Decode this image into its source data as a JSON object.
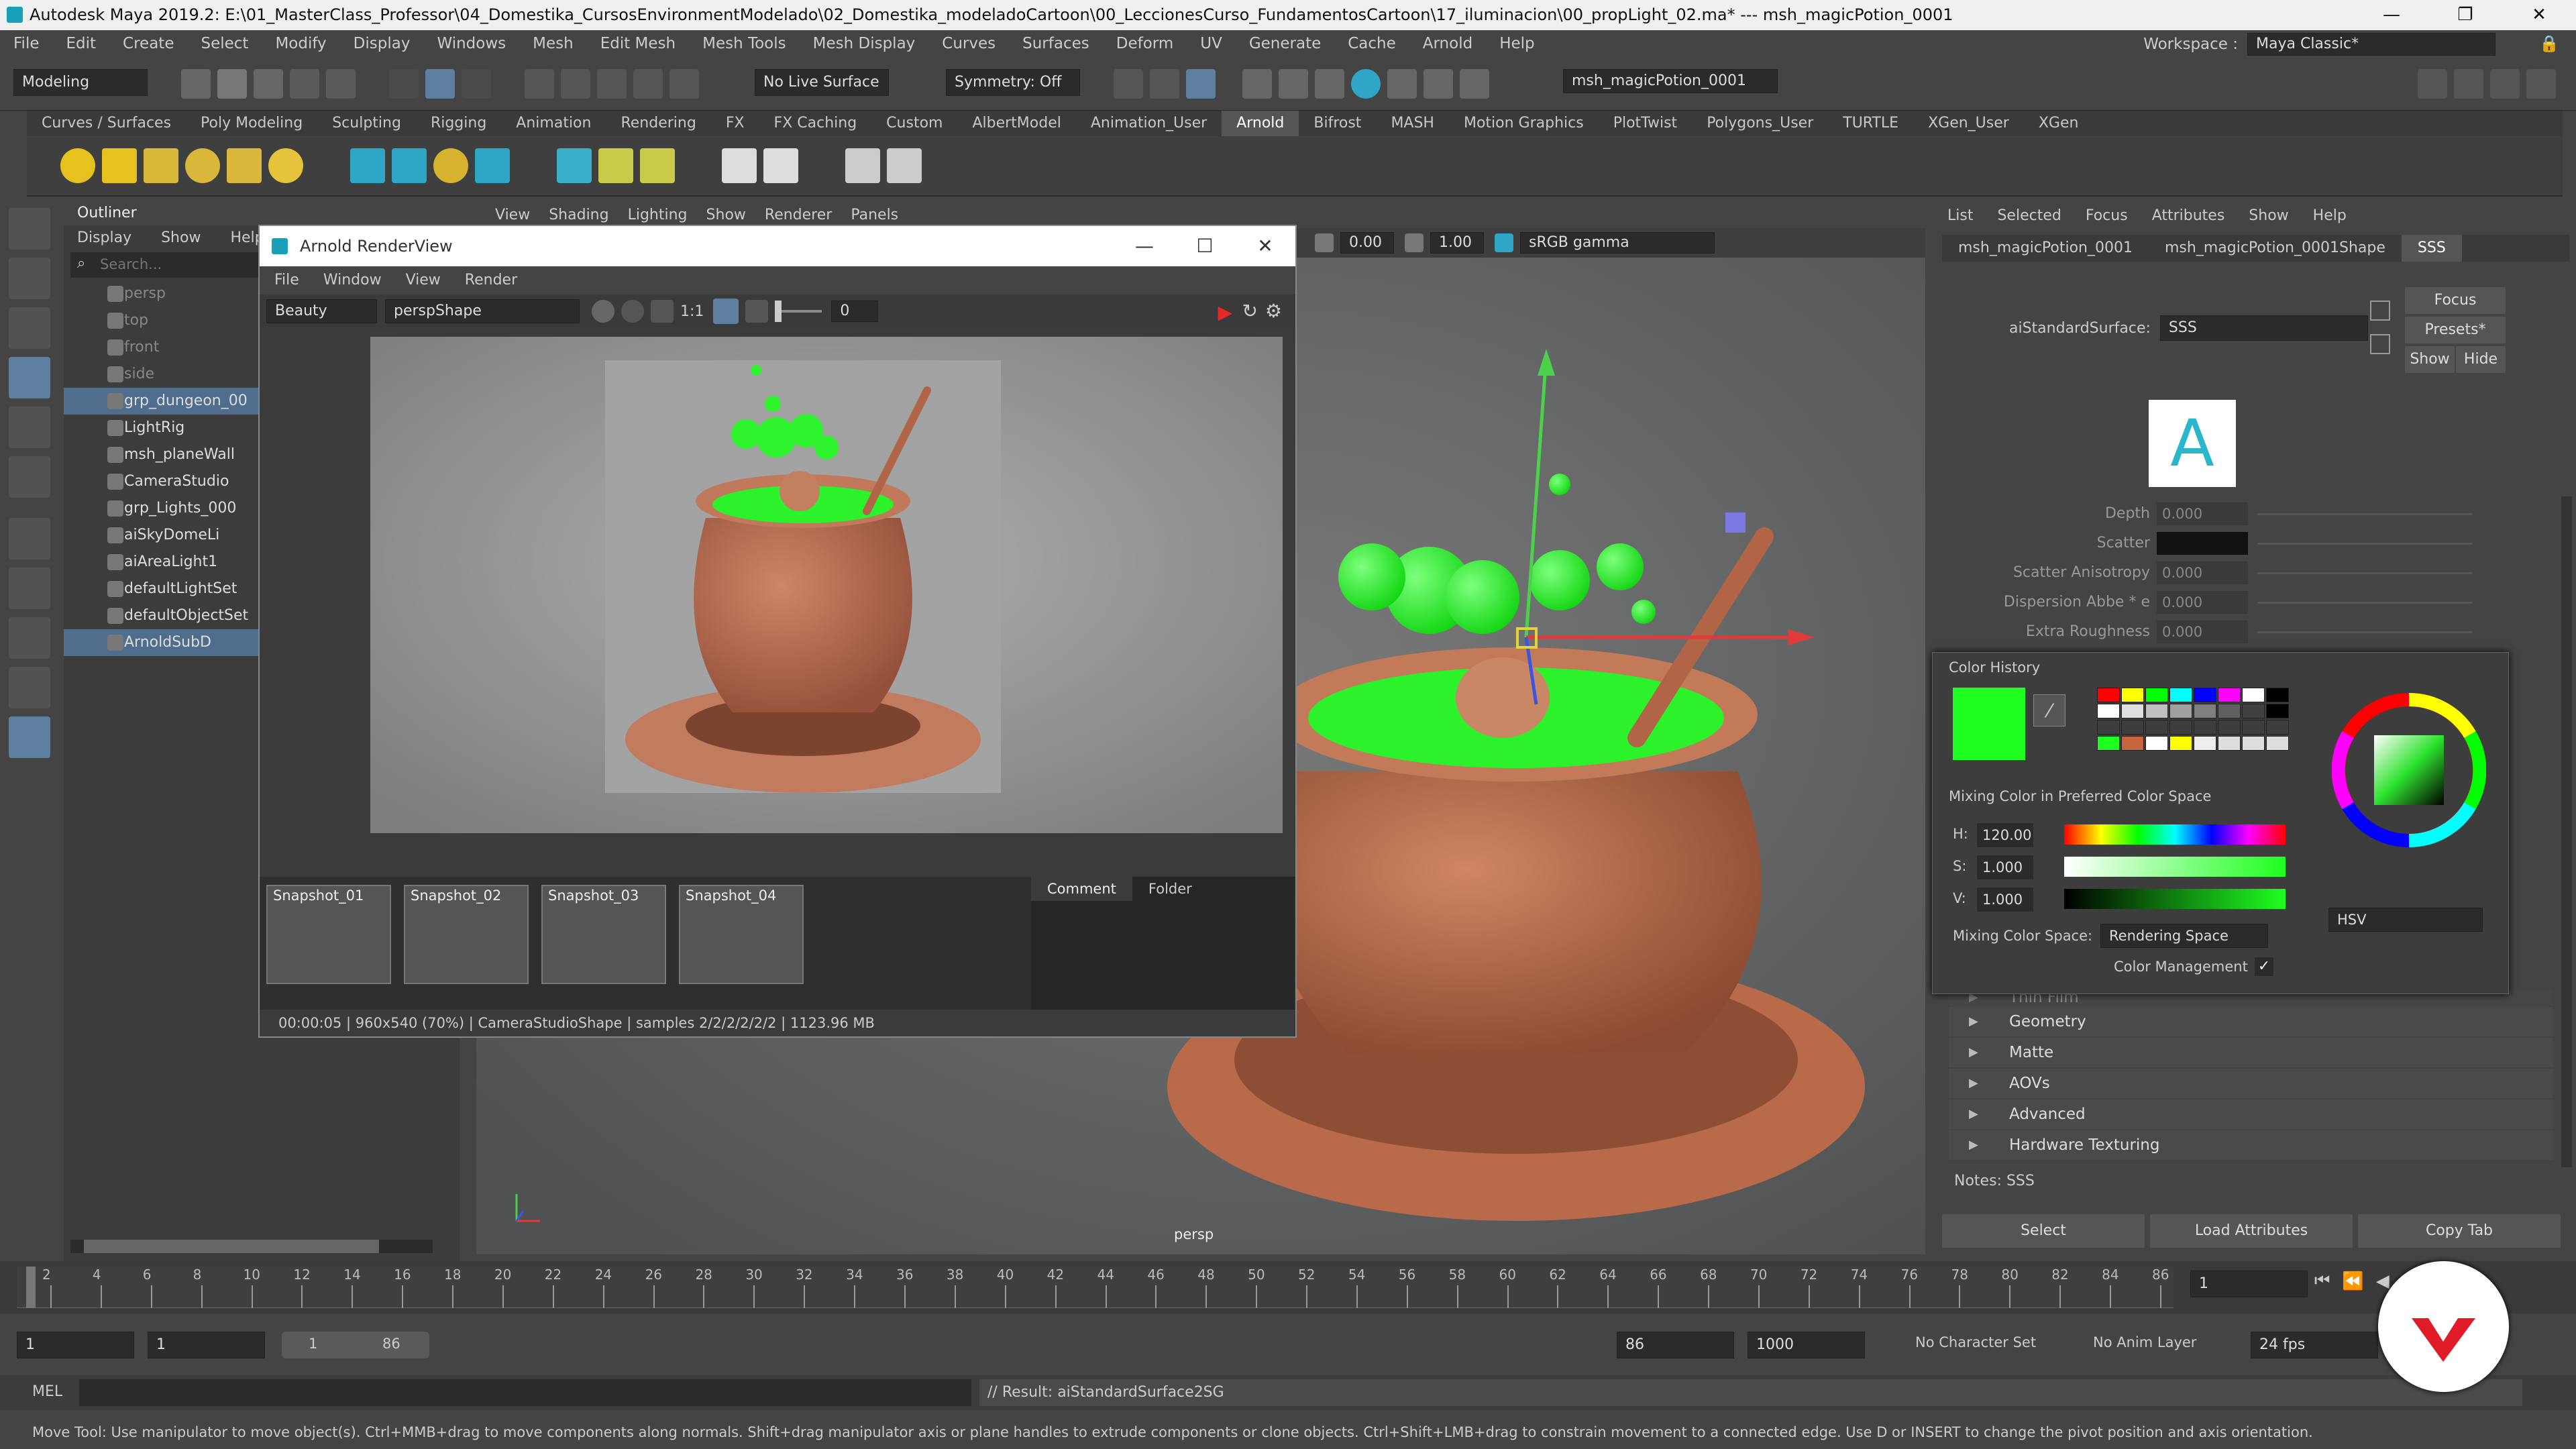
{
  "window": {
    "title": "Autodesk Maya 2019.2: E:\\01_MasterClass_Professor\\04_Domestika_CursosEnvironmentModelado\\02_Domestika_modeladoCartoon\\00_LeccionesCurso_FundamentosCartoon\\17_iluminacion\\00_propLight_02.ma*    ---    msh_magicPotion_0001"
  },
  "menu": [
    "File",
    "Edit",
    "Create",
    "Select",
    "Modify",
    "Display",
    "Windows",
    "Mesh",
    "Edit Mesh",
    "Mesh Tools",
    "Mesh Display",
    "Curves",
    "Surfaces",
    "Deform",
    "UV",
    "Generate",
    "Cache",
    "Arnold",
    "Help"
  ],
  "workspace": {
    "label": "Workspace :",
    "value": "Maya Classic*"
  },
  "toolbar": {
    "mode": "Modeling",
    "live_surface": "No Live Surface",
    "symmetry": "Symmetry: Off",
    "object_field": "msh_magicPotion_0001"
  },
  "shelf_tabs": [
    "Curves / Surfaces",
    "Poly Modeling",
    "Sculpting",
    "Rigging",
    "Animation",
    "Rendering",
    "FX",
    "FX Caching",
    "Custom",
    "AlbertModel",
    "Animation_User",
    "Arnold",
    "Bifrost",
    "MASH",
    "Motion Graphics",
    "PlotTwist",
    "Polygons_User",
    "TURTLE",
    "XGen_User",
    "XGen"
  ],
  "shelf_active": "Arnold",
  "outliner": {
    "title": "Outliner",
    "menu": [
      "Display",
      "Show",
      "Help"
    ],
    "search_placeholder": "Search...",
    "items": [
      {
        "label": "persp",
        "dim": true
      },
      {
        "label": "top",
        "dim": true
      },
      {
        "label": "front",
        "dim": true
      },
      {
        "label": "side",
        "dim": true
      },
      {
        "label": "grp_dungeon_00",
        "sel": true
      },
      {
        "label": "LightRig"
      },
      {
        "label": "msh_planeWall"
      },
      {
        "label": "CameraStudio"
      },
      {
        "label": "grp_Lights_000"
      },
      {
        "label": "aiSkyDomeLi"
      },
      {
        "label": "aiAreaLight1"
      },
      {
        "label": "defaultLightSet"
      },
      {
        "label": "defaultObjectSet"
      },
      {
        "label": "ArnoldSubD",
        "sel": true
      }
    ]
  },
  "viewport": {
    "menu": [
      "View",
      "Shading",
      "Lighting",
      "Show",
      "Renderer",
      "Panels"
    ],
    "exposure": "0.00",
    "gamma": "1.00",
    "color_space": "sRGB gamma",
    "camera_label": "persp"
  },
  "arnold_renderview": {
    "title": "Arnold RenderView",
    "menu": [
      "File",
      "Window",
      "View",
      "Render"
    ],
    "aov": "Beauty",
    "camera": "perspShape",
    "ratio": "1:1",
    "exposure": "0",
    "snapshots": [
      "Snapshot_01",
      "Snapshot_02",
      "Snapshot_03",
      "Snapshot_04"
    ],
    "tabs": [
      "Comment",
      "Folder"
    ],
    "status": "00:00:05 | 960x540 (70%) | CameraStudioShape  | samples 2/2/2/2/2/2 | 1123.96 MB"
  },
  "attribute_editor": {
    "menu": [
      "List",
      "Selected",
      "Focus",
      "Attributes",
      "Show",
      "Help"
    ],
    "tabs": [
      "msh_magicPotion_0001",
      "msh_magicPotion_0001Shape",
      "SSS"
    ],
    "node_label": "aiStandardSurface:",
    "node_value": "SSS",
    "buttons": {
      "focus": "Focus",
      "presets": "Presets*",
      "show": "Show",
      "hide": "Hide"
    },
    "rows": [
      {
        "label": "Depth",
        "value": "0.000"
      },
      {
        "label": "Scatter",
        "value": ""
      },
      {
        "label": "Scatter Anisotropy",
        "value": "0.000"
      },
      {
        "label": "Dispersion Abbe * e",
        "value": "0.000"
      },
      {
        "label": "Extra Roughness",
        "value": "0.000"
      }
    ],
    "sections": [
      "Thin Film",
      "Geometry",
      "Matte",
      "AOVs",
      "Advanced",
      "Hardware Texturing"
    ],
    "notes": "Notes:  SSS",
    "bottom_buttons": [
      "Select",
      "Load Attributes",
      "Copy Tab"
    ]
  },
  "color_picker": {
    "history_label": "Color History",
    "current_color": "#1fff1f",
    "mixing_label": "Mixing Color in Preferred Color Space",
    "h": {
      "label": "H:",
      "value": "120.00"
    },
    "s": {
      "label": "S:",
      "value": "1.000"
    },
    "v": {
      "label": "V:",
      "value": "1.000"
    },
    "space_label": "Mixing Color Space:",
    "space_value": "Rendering Space",
    "mode": "HSV",
    "color_management": "Color Management",
    "history_swatches": [
      "#ff0000",
      "#ffff00",
      "#00ff00",
      "#00ffff",
      "#0000ff",
      "#ff00ff",
      "#ffffff",
      "#000000"
    ]
  },
  "timeline": {
    "ticks": [
      "2",
      "4",
      "6",
      "8",
      "10",
      "12",
      "14",
      "16",
      "18",
      "20",
      "22",
      "24",
      "26",
      "28",
      "30",
      "32",
      "34",
      "36",
      "38",
      "40",
      "42",
      "44",
      "46",
      "48",
      "50",
      "52",
      "54",
      "56",
      "58",
      "60",
      "62",
      "64",
      "66",
      "68",
      "70",
      "72",
      "74",
      "76",
      "78",
      "80",
      "82",
      "84",
      "86"
    ],
    "current_frame": "1"
  },
  "range": {
    "start": "1",
    "start2": "1",
    "slider_start": "1",
    "slider_end": "86",
    "end": "86",
    "end2": "1000",
    "char_set": "No Character Set",
    "anim_layer": "No Anim Layer",
    "fps": "24 fps"
  },
  "cmd": {
    "lang": "MEL",
    "result": "// Result: aiStandardSurface2SG"
  },
  "help_line": "Move Tool: Use manipulator to move object(s). Ctrl+MMB+drag to move components along normals. Shift+drag manipulator axis or plane handles to extrude components or clone objects. Ctrl+Shift+LMB+drag to constrain movement to a connected edge. Use D or INSERT to change the pivot position and axis orientation."
}
